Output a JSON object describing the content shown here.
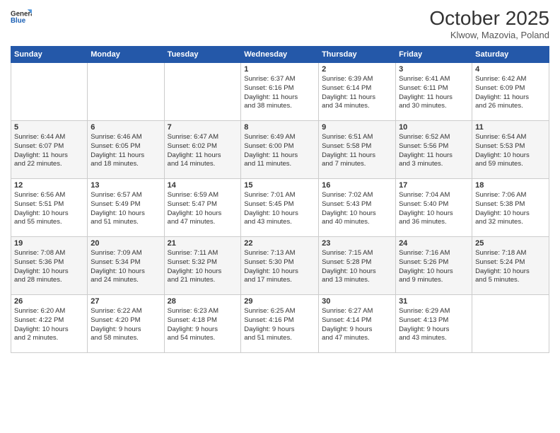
{
  "logo": {
    "line1": "General",
    "line2": "Blue"
  },
  "header": {
    "month": "October 2025",
    "location": "Klwow, Mazovia, Poland"
  },
  "days_of_week": [
    "Sunday",
    "Monday",
    "Tuesday",
    "Wednesday",
    "Thursday",
    "Friday",
    "Saturday"
  ],
  "weeks": [
    [
      {
        "day": "",
        "info": ""
      },
      {
        "day": "",
        "info": ""
      },
      {
        "day": "",
        "info": ""
      },
      {
        "day": "1",
        "info": "Sunrise: 6:37 AM\nSunset: 6:16 PM\nDaylight: 11 hours\nand 38 minutes."
      },
      {
        "day": "2",
        "info": "Sunrise: 6:39 AM\nSunset: 6:14 PM\nDaylight: 11 hours\nand 34 minutes."
      },
      {
        "day": "3",
        "info": "Sunrise: 6:41 AM\nSunset: 6:11 PM\nDaylight: 11 hours\nand 30 minutes."
      },
      {
        "day": "4",
        "info": "Sunrise: 6:42 AM\nSunset: 6:09 PM\nDaylight: 11 hours\nand 26 minutes."
      }
    ],
    [
      {
        "day": "5",
        "info": "Sunrise: 6:44 AM\nSunset: 6:07 PM\nDaylight: 11 hours\nand 22 minutes."
      },
      {
        "day": "6",
        "info": "Sunrise: 6:46 AM\nSunset: 6:05 PM\nDaylight: 11 hours\nand 18 minutes."
      },
      {
        "day": "7",
        "info": "Sunrise: 6:47 AM\nSunset: 6:02 PM\nDaylight: 11 hours\nand 14 minutes."
      },
      {
        "day": "8",
        "info": "Sunrise: 6:49 AM\nSunset: 6:00 PM\nDaylight: 11 hours\nand 11 minutes."
      },
      {
        "day": "9",
        "info": "Sunrise: 6:51 AM\nSunset: 5:58 PM\nDaylight: 11 hours\nand 7 minutes."
      },
      {
        "day": "10",
        "info": "Sunrise: 6:52 AM\nSunset: 5:56 PM\nDaylight: 11 hours\nand 3 minutes."
      },
      {
        "day": "11",
        "info": "Sunrise: 6:54 AM\nSunset: 5:53 PM\nDaylight: 10 hours\nand 59 minutes."
      }
    ],
    [
      {
        "day": "12",
        "info": "Sunrise: 6:56 AM\nSunset: 5:51 PM\nDaylight: 10 hours\nand 55 minutes."
      },
      {
        "day": "13",
        "info": "Sunrise: 6:57 AM\nSunset: 5:49 PM\nDaylight: 10 hours\nand 51 minutes."
      },
      {
        "day": "14",
        "info": "Sunrise: 6:59 AM\nSunset: 5:47 PM\nDaylight: 10 hours\nand 47 minutes."
      },
      {
        "day": "15",
        "info": "Sunrise: 7:01 AM\nSunset: 5:45 PM\nDaylight: 10 hours\nand 43 minutes."
      },
      {
        "day": "16",
        "info": "Sunrise: 7:02 AM\nSunset: 5:43 PM\nDaylight: 10 hours\nand 40 minutes."
      },
      {
        "day": "17",
        "info": "Sunrise: 7:04 AM\nSunset: 5:40 PM\nDaylight: 10 hours\nand 36 minutes."
      },
      {
        "day": "18",
        "info": "Sunrise: 7:06 AM\nSunset: 5:38 PM\nDaylight: 10 hours\nand 32 minutes."
      }
    ],
    [
      {
        "day": "19",
        "info": "Sunrise: 7:08 AM\nSunset: 5:36 PM\nDaylight: 10 hours\nand 28 minutes."
      },
      {
        "day": "20",
        "info": "Sunrise: 7:09 AM\nSunset: 5:34 PM\nDaylight: 10 hours\nand 24 minutes."
      },
      {
        "day": "21",
        "info": "Sunrise: 7:11 AM\nSunset: 5:32 PM\nDaylight: 10 hours\nand 21 minutes."
      },
      {
        "day": "22",
        "info": "Sunrise: 7:13 AM\nSunset: 5:30 PM\nDaylight: 10 hours\nand 17 minutes."
      },
      {
        "day": "23",
        "info": "Sunrise: 7:15 AM\nSunset: 5:28 PM\nDaylight: 10 hours\nand 13 minutes."
      },
      {
        "day": "24",
        "info": "Sunrise: 7:16 AM\nSunset: 5:26 PM\nDaylight: 10 hours\nand 9 minutes."
      },
      {
        "day": "25",
        "info": "Sunrise: 7:18 AM\nSunset: 5:24 PM\nDaylight: 10 hours\nand 5 minutes."
      }
    ],
    [
      {
        "day": "26",
        "info": "Sunrise: 6:20 AM\nSunset: 4:22 PM\nDaylight: 10 hours\nand 2 minutes."
      },
      {
        "day": "27",
        "info": "Sunrise: 6:22 AM\nSunset: 4:20 PM\nDaylight: 9 hours\nand 58 minutes."
      },
      {
        "day": "28",
        "info": "Sunrise: 6:23 AM\nSunset: 4:18 PM\nDaylight: 9 hours\nand 54 minutes."
      },
      {
        "day": "29",
        "info": "Sunrise: 6:25 AM\nSunset: 4:16 PM\nDaylight: 9 hours\nand 51 minutes."
      },
      {
        "day": "30",
        "info": "Sunrise: 6:27 AM\nSunset: 4:14 PM\nDaylight: 9 hours\nand 47 minutes."
      },
      {
        "day": "31",
        "info": "Sunrise: 6:29 AM\nSunset: 4:13 PM\nDaylight: 9 hours\nand 43 minutes."
      },
      {
        "day": "",
        "info": ""
      }
    ]
  ]
}
